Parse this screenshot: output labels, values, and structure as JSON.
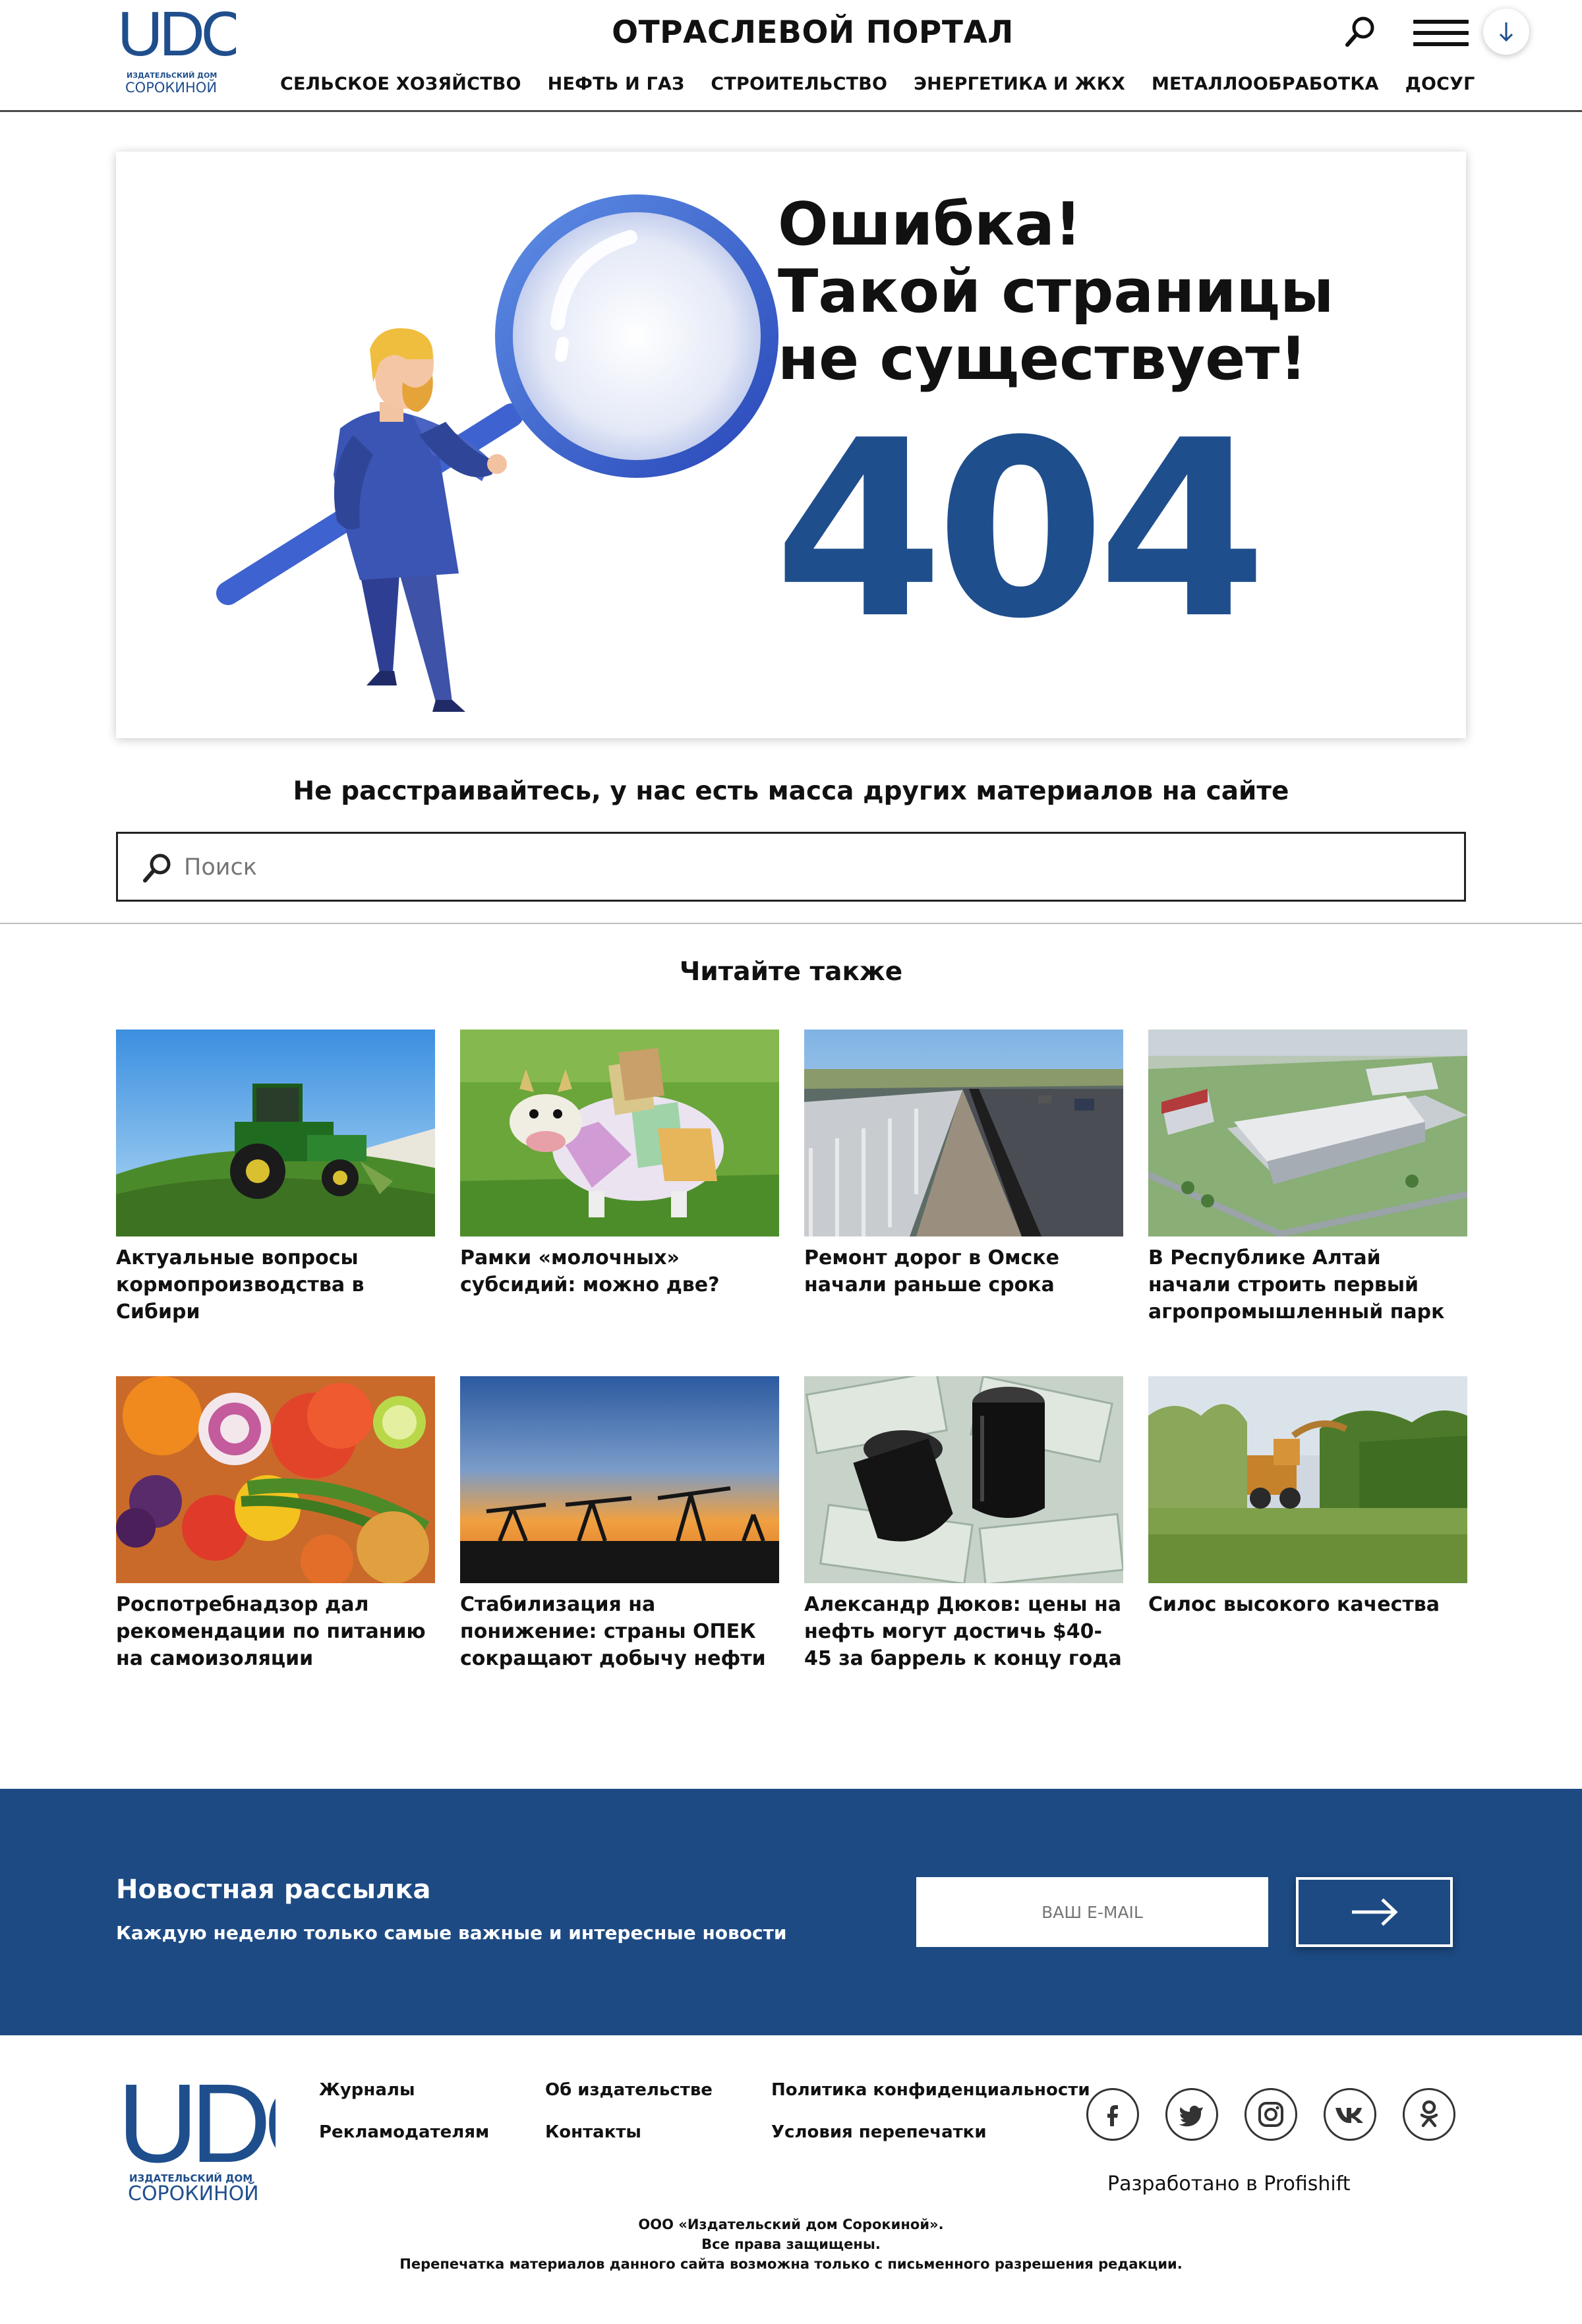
{
  "header": {
    "logo_text": "UDC",
    "logo_publisher": "ИЗДАТЕЛЬСКИЙ ДОМ",
    "logo_name": "СОРОКИНОЙ",
    "portal_title": "ОТРАСЛЕВОЙ ПОРТАЛ",
    "nav": [
      "СЕЛЬСКОЕ ХОЗЯЙСТВО",
      "НЕФТЬ И ГАЗ",
      "СТРОИТЕЛЬСТВО",
      "ЭНЕРГЕТИКА И ЖКХ",
      "МЕТАЛЛООБРАБОТКА",
      "ДОСУГ"
    ],
    "icons": [
      "search-icon",
      "menu-icon",
      "arrow-down-icon"
    ]
  },
  "error": {
    "title_line1": "Ошибка!",
    "title_line2": "Такой страницы",
    "title_line3": "не существует!",
    "code": "404"
  },
  "search": {
    "suggest": "Не расстраивайтесь, у нас есть масса других материалов на сайте",
    "placeholder": "Поиск"
  },
  "read_also": {
    "title": "Читайте также",
    "articles": [
      "Актуальные вопросы кормопроизводства в Сибири",
      "Рамки «молочных» субсидий: можно две?",
      "Ремонт дорог в Омске начали раньше срока",
      "В Республике Алтай начали строить первый агропромышленный парк",
      "Роспотребнадзор дал рекомендации по питанию на самоизоляции",
      "Стабилизация на понижение: страны ОПЕК сокращают добычу нефти",
      "Александр Дюков: цены на нефть могут достичь $40-45 за баррель к концу года",
      "Силос высокого качества"
    ]
  },
  "newsletter": {
    "title": "Новостная рассылка",
    "subtitle": "Каждую неделю только самые важные и интересные новости",
    "email_placeholder": "ВАШ E-MAIL"
  },
  "footer": {
    "links": [
      "Журналы",
      "Рекламодателям",
      "Об издательстве",
      "Контакты",
      "Политика конфиденциальности",
      "Условия перепечатки"
    ],
    "social": [
      "facebook-icon",
      "twitter-icon",
      "instagram-icon",
      "vk-icon",
      "odnoklassniki-icon"
    ],
    "developer": "Разработано в Profishift",
    "copyright_1": "ООО «Издательский дом Сорокиной».",
    "copyright_2": "Все права защищены.",
    "copyright_3": "Перепечатка материалов данного сайта возможна только с письменного разрешения редакции."
  },
  "colors": {
    "brand_blue": "#1f4e8d",
    "newsletter_bg": "#1d4a83"
  }
}
